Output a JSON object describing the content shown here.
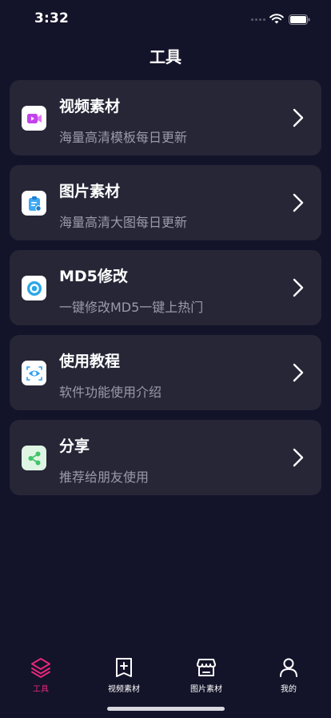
{
  "status_bar": {
    "time": "3:32"
  },
  "page": {
    "title": "工具"
  },
  "cards": [
    {
      "title": "视频素材",
      "desc": "海量高清模板每日更新",
      "icon": "video-icon",
      "icon_color": "#c243ee"
    },
    {
      "title": "图片素材",
      "desc": "海量高清大图每日更新",
      "icon": "clipboard-icon",
      "icon_color": "#3ea9f5"
    },
    {
      "title": "MD5修改",
      "desc": "一键修改MD5一键上热门",
      "icon": "ring-icon",
      "icon_color": "#2aa7e6"
    },
    {
      "title": "使用教程",
      "desc": "软件功能使用介绍",
      "icon": "eye-scan-icon",
      "icon_color": "#2f9ff2"
    },
    {
      "title": "分享",
      "desc": "推荐给朋友使用",
      "icon": "share-icon",
      "icon_color": "#3fc46a"
    }
  ],
  "tabs": [
    {
      "label": "工具",
      "icon": "layers-icon",
      "active": true
    },
    {
      "label": "视频素材",
      "icon": "add-box-icon",
      "active": false
    },
    {
      "label": "图片素材",
      "icon": "store-icon",
      "active": false
    },
    {
      "label": "我的",
      "icon": "person-icon",
      "active": false
    }
  ],
  "colors": {
    "background": "#13132a",
    "card": "#262637",
    "accent": "#e8267d",
    "secondary_text": "#9a9aab"
  }
}
